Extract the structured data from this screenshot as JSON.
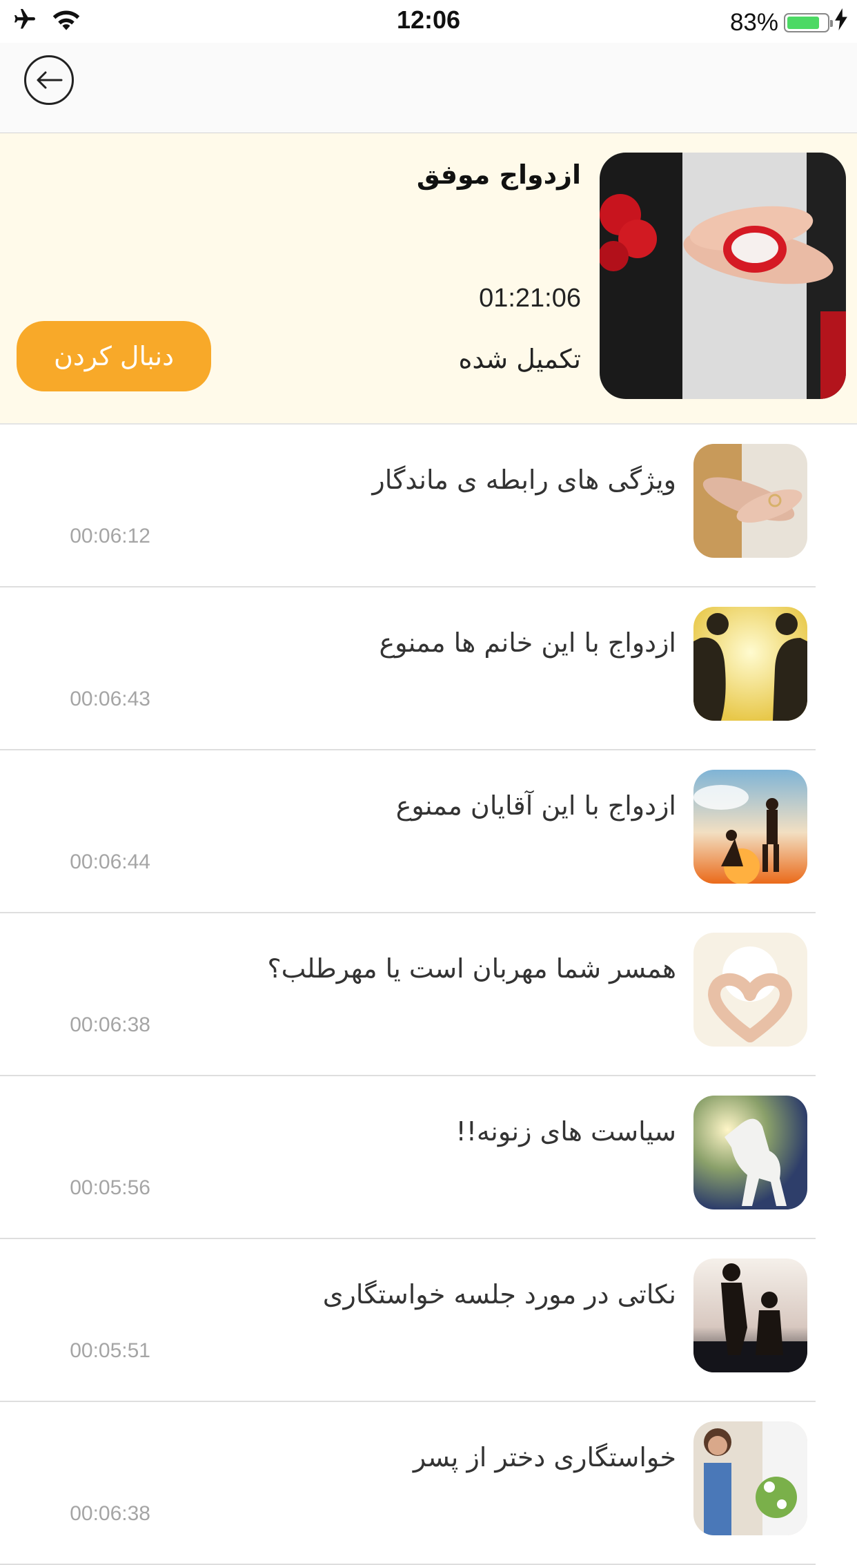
{
  "status_bar": {
    "time": "12:06",
    "battery_percent": "83%",
    "battery_level": 0.83,
    "icons": [
      "airplane-icon",
      "wifi-icon",
      "battery-icon",
      "charging-bolt-icon"
    ]
  },
  "nav": {
    "back_icon": "arrow-left-icon"
  },
  "course": {
    "title": "ازدواج موفق",
    "duration": "01:21:06",
    "status": "تکمیل شده",
    "follow_label": "دنبال کردن",
    "accent_color": "#f8a929",
    "background_color": "#fffaea"
  },
  "episodes": [
    {
      "title": "ویژگی های رابطه ی ماندگار",
      "duration": "00:06:12"
    },
    {
      "title": "ازدواج با این خانم ها ممنوع",
      "duration": "00:06:43"
    },
    {
      "title": "ازدواج با این آقایان ممنوع",
      "duration": "00:06:44"
    },
    {
      "title": "همسر شما مهربان است یا مهرطلب؟",
      "duration": "00:06:38"
    },
    {
      "title": "سیاست های زنونه!!",
      "duration": "00:05:56"
    },
    {
      "title": "نکاتی در مورد جلسه خواستگاری",
      "duration": "00:05:51"
    },
    {
      "title": "خواستگاری دختر از پسر",
      "duration": "00:06:38"
    }
  ]
}
